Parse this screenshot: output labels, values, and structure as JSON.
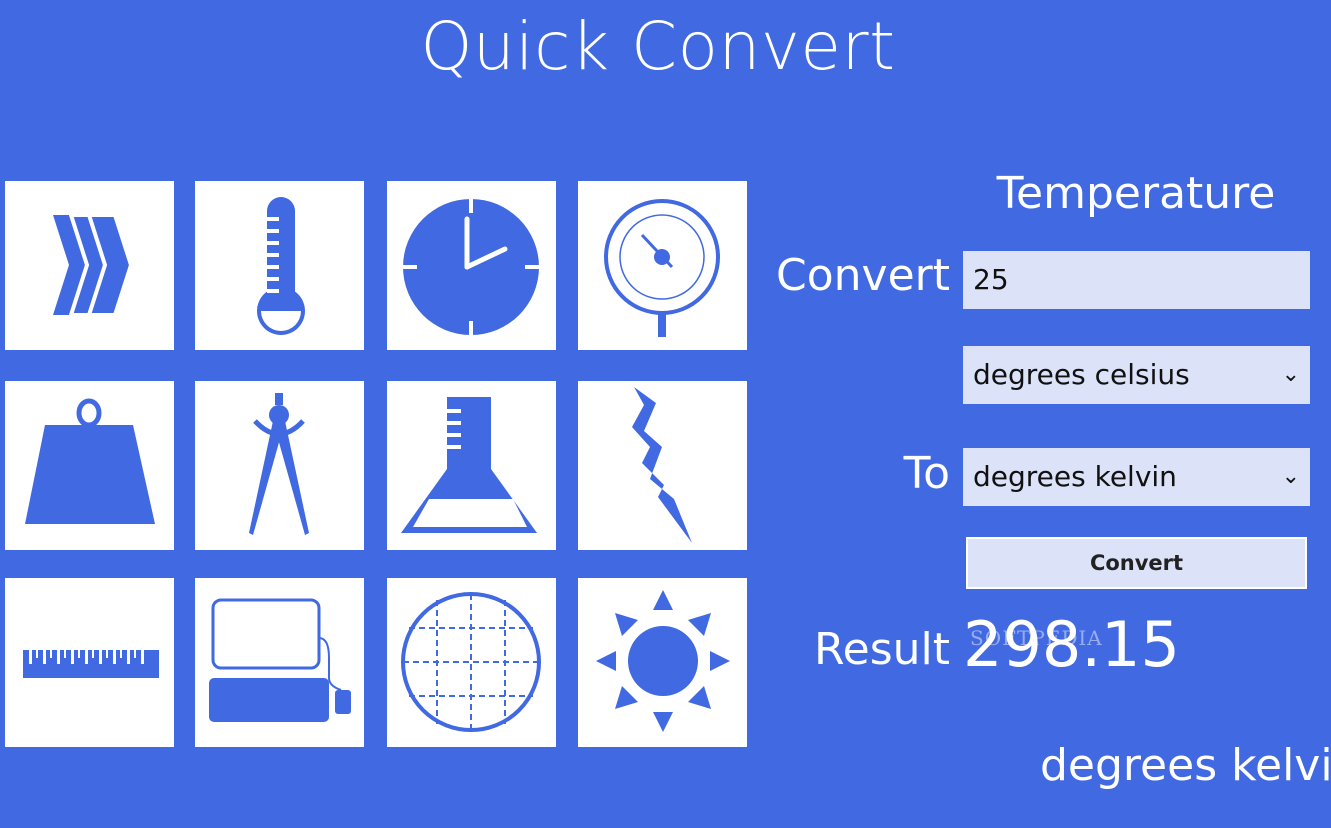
{
  "app": {
    "title": "Quick Convert"
  },
  "categories": [
    {
      "icon": "chevrons-icon"
    },
    {
      "icon": "thermometer-icon"
    },
    {
      "icon": "clock-icon"
    },
    {
      "icon": "pressure-gauge-icon"
    },
    {
      "icon": "weight-icon"
    },
    {
      "icon": "compass-drawing-icon"
    },
    {
      "icon": "flask-icon"
    },
    {
      "icon": "lightning-bolt-icon"
    },
    {
      "icon": "ruler-icon"
    },
    {
      "icon": "computer-icon"
    },
    {
      "icon": "globe-grid-icon"
    },
    {
      "icon": "sun-icon"
    }
  ],
  "converter": {
    "section_title": "Temperature",
    "convert_label": "Convert",
    "input_value": "25",
    "from_unit": "degrees celsius",
    "to_label": "To",
    "to_unit": "degrees kelvin",
    "convert_button": "Convert",
    "result_label": "Result",
    "result_value": "298.15",
    "result_unit": "degrees kelvin"
  },
  "watermark": "SOFTPEDIA",
  "colors": {
    "background": "#4169E1",
    "tile": "#FFFFFF",
    "icon": "#4169E1",
    "field": "#DCE3F9"
  }
}
